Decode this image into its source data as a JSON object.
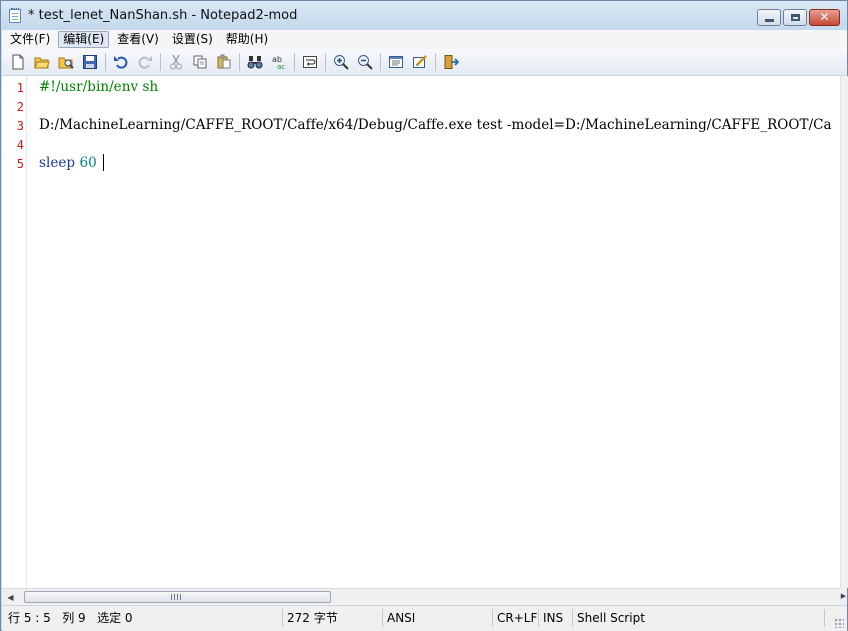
{
  "window": {
    "title": "* test_lenet_NanShan.sh - Notepad2-mod",
    "controls": {
      "minimize": "minimize-icon",
      "maximize": "maximize-icon",
      "close": "close-icon",
      "close_glyph": "✕"
    }
  },
  "menu": [
    {
      "label": "文件(F)",
      "active": false
    },
    {
      "label": "编辑(E)",
      "active": true
    },
    {
      "label": "查看(V)",
      "active": false
    },
    {
      "label": "设置(S)",
      "active": false
    },
    {
      "label": "帮助(H)",
      "active": false
    }
  ],
  "toolbar_icons": [
    "new-file-icon",
    "open-folder-icon",
    "browse-icon",
    "save-icon",
    "undo-icon",
    "redo-icon",
    "cut-icon",
    "copy-icon",
    "paste-icon",
    "find-icon",
    "replace-icon",
    "word-wrap-icon",
    "zoom-in-icon",
    "zoom-out-icon",
    "view-icon",
    "edit-settings-icon",
    "exit-icon"
  ],
  "editor": {
    "lines": [
      {
        "number": "1",
        "text": "#!/usr/bin/env sh"
      },
      {
        "number": "2",
        "text": ""
      },
      {
        "number": "3",
        "text": "D:/MachineLearning/CAFFE_ROOT/Caffe/x64/Debug/Caffe.exe test -model=D:/MachineLearning/CAFFE_ROOT/Ca"
      },
      {
        "number": "4",
        "text": ""
      },
      {
        "number": "5",
        "keyword": "sleep",
        "space": " ",
        "value": "60"
      }
    ],
    "colors": {
      "shebang": "#008000",
      "line_number": "#c81818",
      "number": "#008080",
      "keyword": "#1a3a9a"
    }
  },
  "scrollbar": {
    "left_arrow": "◀",
    "right_arrow": "▶"
  },
  "status": {
    "position": "行 5 : 5   列 9   选定 0",
    "size": "272 字节",
    "encoding": "ANSI",
    "line_ending": "CR+LF",
    "mode": "INS",
    "lexer": "Shell Script"
  }
}
